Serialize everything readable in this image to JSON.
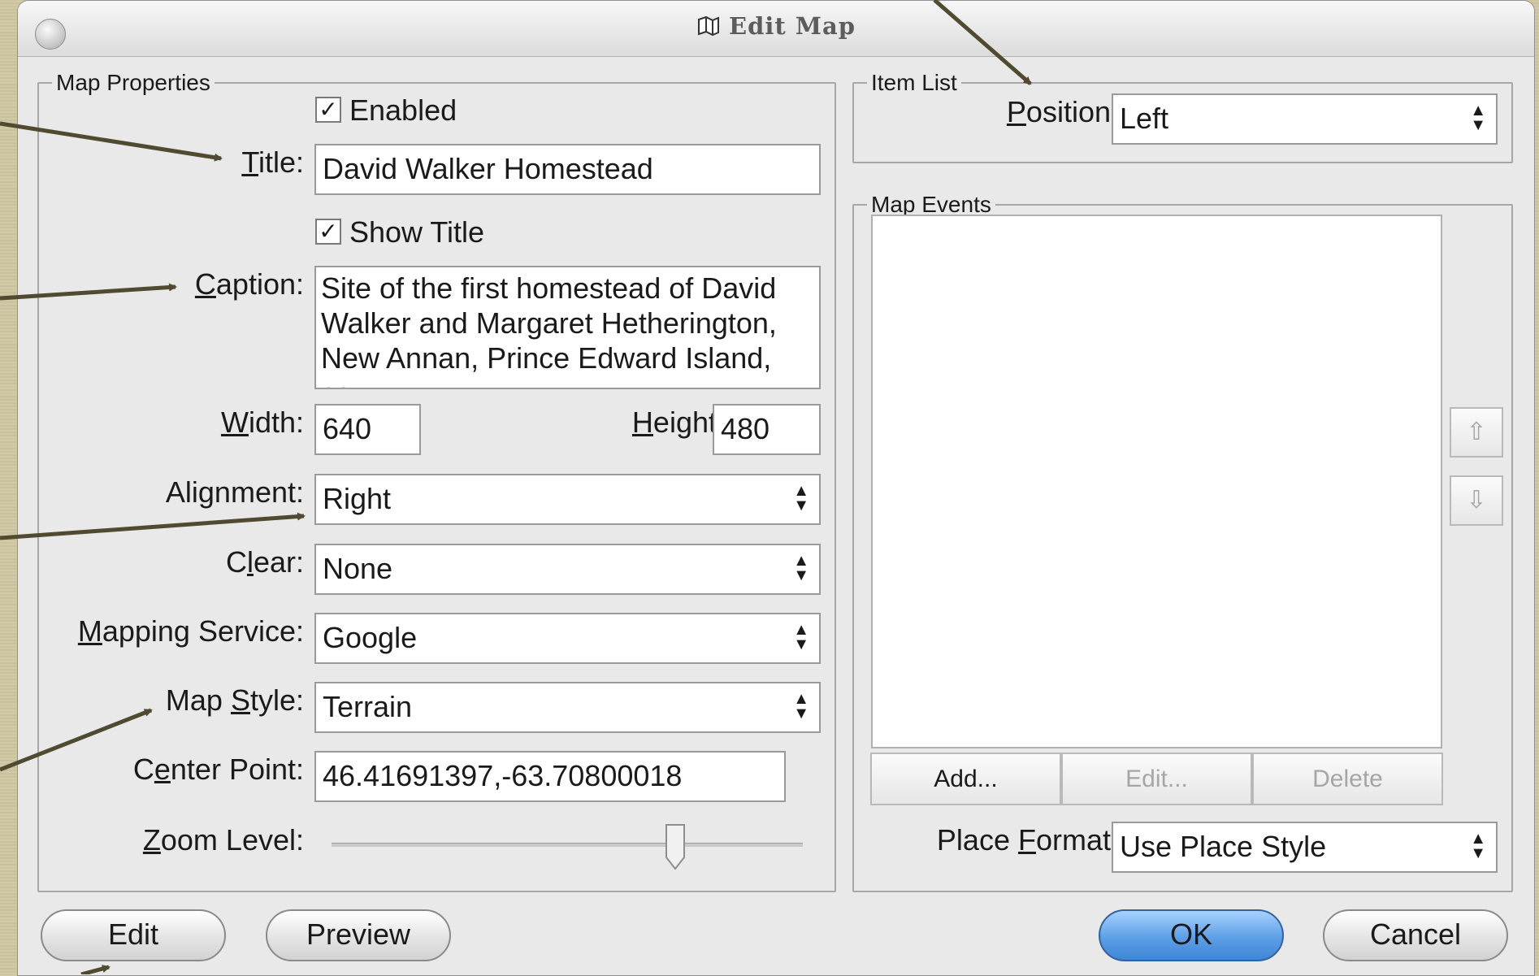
{
  "window": {
    "title": "Edit Map"
  },
  "map_properties": {
    "legend": "Map Properties",
    "enabled": {
      "label": "Enabled",
      "checked": true
    },
    "title": {
      "label": "Title:",
      "value": "David Walker Homestead"
    },
    "show_title": {
      "label": "Show Title",
      "checked": true
    },
    "caption": {
      "label": "Caption:",
      "value": "Site of the first homestead of David Walker and Margaret Hetherington, New Annan, Prince Edward Island, ca."
    },
    "width": {
      "label": "Width:",
      "value": "640"
    },
    "height": {
      "label": "Height:",
      "value": "480"
    },
    "alignment": {
      "label": "Alignment:",
      "value": "Right"
    },
    "clear": {
      "label": "Clear:",
      "value": "None"
    },
    "mapping_service": {
      "label": "Mapping Service:",
      "value": "Google"
    },
    "map_style": {
      "label": "Map Style:",
      "value": "Terrain"
    },
    "center_point": {
      "label": "Center Point:",
      "value": "46.41691397,-63.70800018"
    },
    "zoom_level": {
      "label": "Zoom Level:",
      "value_fraction": 0.73
    }
  },
  "item_list": {
    "legend": "Item List",
    "position": {
      "label": "Position:",
      "value": "Left"
    }
  },
  "map_events": {
    "legend": "Map Events",
    "items": [],
    "add_label": "Add...",
    "edit_label": "Edit...",
    "delete_label": "Delete",
    "move_up_icon": "arrow-up-icon",
    "move_down_icon": "arrow-down-icon"
  },
  "place_format": {
    "label": "Place Format:",
    "value": "Use Place Style"
  },
  "buttons": {
    "edit": "Edit",
    "preview": "Preview",
    "ok": "OK",
    "cancel": "Cancel"
  },
  "colors": {
    "annotation_arrow": "#4f4a30",
    "ok_button": "#5d9fe6",
    "window_bg": "#e9e9e9",
    "page_bg": "#cfc7a2"
  }
}
